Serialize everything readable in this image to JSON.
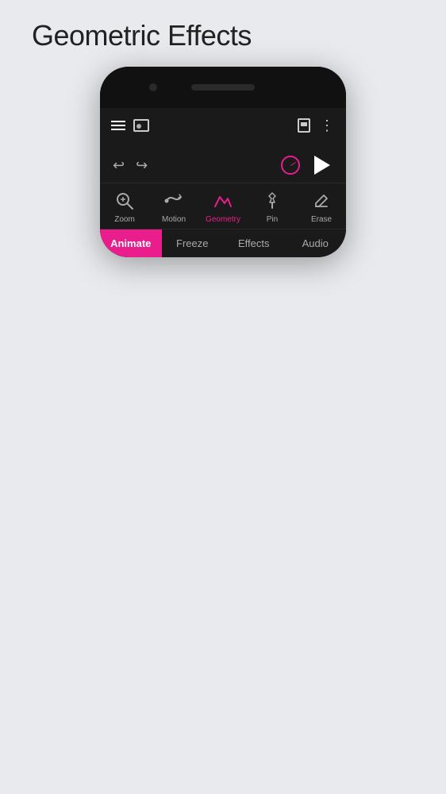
{
  "page": {
    "title": "Geometric Effects"
  },
  "app": {
    "topbar": {
      "save_icon": "save",
      "more_icon": "more"
    }
  },
  "toolbar": {
    "tools": [
      {
        "id": "zoom",
        "label": "Zoom",
        "active": false
      },
      {
        "id": "motion",
        "label": "Motion",
        "active": false
      },
      {
        "id": "geometry",
        "label": "Geometry",
        "active": true
      },
      {
        "id": "pin",
        "label": "Pin",
        "active": false
      },
      {
        "id": "erase",
        "label": "Erase",
        "active": false
      }
    ]
  },
  "tabs": [
    {
      "id": "animate",
      "label": "Animate",
      "active": true
    },
    {
      "id": "freeze",
      "label": "Freeze",
      "active": false
    },
    {
      "id": "effects",
      "label": "Effects",
      "active": false
    },
    {
      "id": "audio",
      "label": "Audio",
      "active": false
    }
  ],
  "colors": {
    "accent": "#e91e8c",
    "bg_dark": "#1a1a1a",
    "text_active": "#e91e8c",
    "text_inactive": "#aaa",
    "white": "#ffffff"
  }
}
